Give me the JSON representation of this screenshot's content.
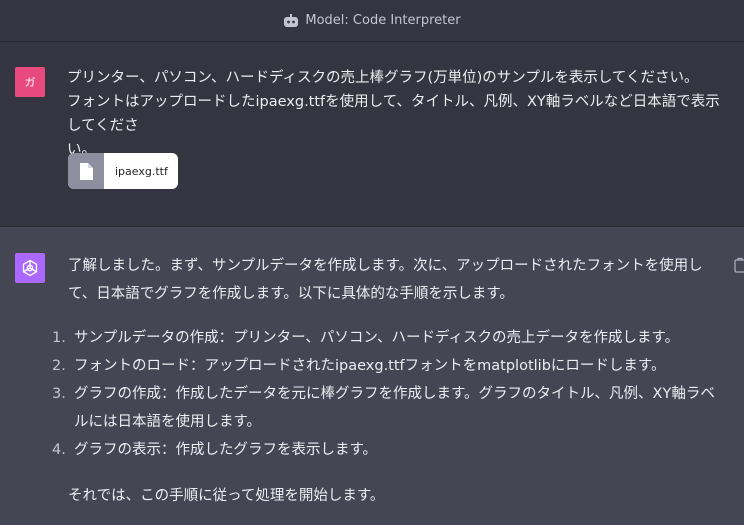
{
  "header": {
    "model_label": "Model: Code Interpreter",
    "icon": "model-plugin-icon"
  },
  "user_message": {
    "avatar_initial": "ガ",
    "avatar_color": "#e84a7f",
    "text": "プリンター、パソコン、ハードディスクの売上棒グラフ(万単位)のサンプルを表示してください。\nフォントはアップロードしたipaexg.ttfを使用して、タイトル、凡例、XY軸ラベルなど日本語で表示してくださ\nい。",
    "attachment": {
      "filename": "ipaexg.ttf",
      "icon": "file-icon"
    }
  },
  "assistant_message": {
    "avatar_color": "#ab68ff",
    "avatar_icon": "openai-logo-icon",
    "intro": "了解しました。まず、サンプルデータを作成します。次に、アップロードされたフォントを使用して、日本語でグラフを作成します。以下に具体的な手順を示します。",
    "steps": [
      {
        "num": "1.",
        "text": "サンプルデータの作成：プリンター、パソコン、ハードディスクの売上データを作成します。"
      },
      {
        "num": "2.",
        "text": "フォントのロード：アップロードされたipaexg.ttfフォントをmatplotlibにロードします。"
      },
      {
        "num": "3.",
        "text": "グラフの作成：作成したデータを元に棒グラフを作成します。グラフのタイトル、凡例、XY軸ラベルには日本語を使用します。"
      },
      {
        "num": "4.",
        "text": "グラフの表示：作成したグラフを表示します。"
      }
    ],
    "outro": "それでは、この手順に従って処理を開始します。"
  },
  "colors": {
    "page_bg": "#343541",
    "assistant_bg": "#444654",
    "text": "#ececf1"
  }
}
